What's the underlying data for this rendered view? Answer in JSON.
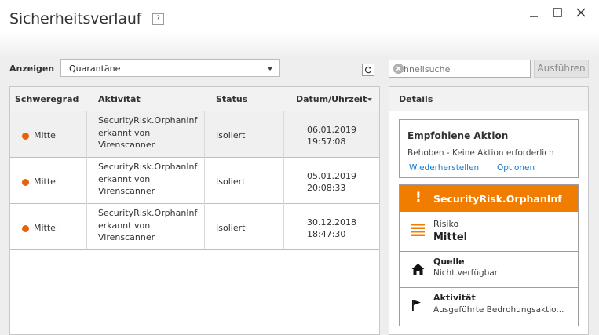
{
  "window": {
    "title": "Sicherheitsverlauf",
    "help": "?"
  },
  "filter": {
    "label": "Anzeigen",
    "selected": "Quarantäne"
  },
  "table": {
    "columns": [
      "Schweregrad",
      "Aktivität",
      "Status",
      "Datum/Uhrzeit"
    ],
    "rows": [
      {
        "severity": "Mittel",
        "activity": [
          "SecurityRisk.OrphanInf",
          "erkannt von",
          "Virenscanner"
        ],
        "status": "Isoliert",
        "date": "06.01.2019",
        "time": "19:57:08"
      },
      {
        "severity": "Mittel",
        "activity": [
          "SecurityRisk.OrphanInf",
          "erkannt von",
          "Virenscanner"
        ],
        "status": "Isoliert",
        "date": "05.01.2019",
        "time": "20:08:33"
      },
      {
        "severity": "Mittel",
        "activity": [
          "SecurityRisk.OrphanInf",
          "erkannt von",
          "Virenscanner"
        ],
        "status": "Isoliert",
        "date": "30.12.2018",
        "time": "18:47:30"
      }
    ]
  },
  "search": {
    "placeholder": "Schnellsuche",
    "button": "Ausführen"
  },
  "details": {
    "header": "Details",
    "recommended": {
      "title": "Empfohlene Aktion",
      "text": "Behoben - Keine Aktion erforderlich",
      "link_restore": "Wiederherstellen",
      "link_options": "Optionen"
    },
    "threat_name": "SecurityRisk.OrphanInf",
    "threat_mark": "!",
    "risk_label": "Risiko",
    "risk_value": "Mittel",
    "source_label": "Quelle",
    "source_value": "Nicht verfügbar",
    "activity_label": "Aktivität",
    "activity_value": "Ausgeführte Bedrohungsaktio..."
  },
  "colors": {
    "accent": "#f07d00",
    "severity_dot": "#e8620a",
    "link": "#1a78c9"
  }
}
